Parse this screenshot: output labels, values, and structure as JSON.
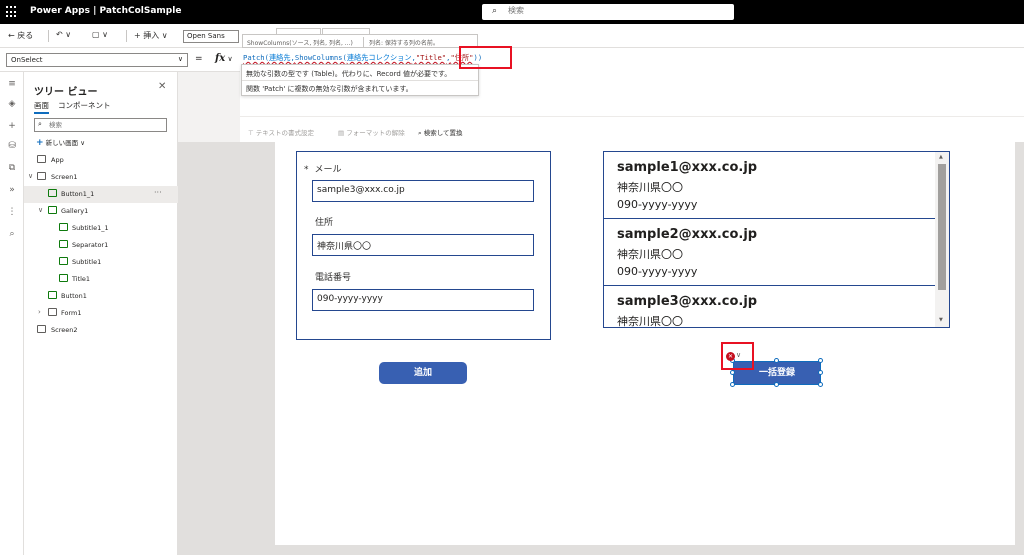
{
  "titlebar": {
    "app_title": "Power Apps | PatchColSample",
    "search_placeholder": "検索"
  },
  "commandbar": {
    "back_label": "戻る",
    "insert_label": "挿入",
    "font_value": "Open Sans"
  },
  "formulabar": {
    "property": "OnSelect",
    "equals": "=",
    "fx": "fx",
    "formula": {
      "part1": "Patch(",
      "part2": "連絡先",
      "part3": ",",
      "part4": "ShowColumns(",
      "part5": "連絡先コレクション",
      "part6": ",",
      "part7": "\"Title\"",
      "part8": ",",
      "part9": "\"住所\"",
      "part10": "))"
    },
    "tooltip_signature": "ShowColumns(ソース, 列名, 列名, ...)",
    "tooltip_param": "列名: 保持する列の名前。",
    "errors": [
      "無効な引数の型です (Table)。代わりに、Record 値が必要です。",
      "関数 'Patch' に複数の無効な引数が含まれています。"
    ],
    "text_toolbar": {
      "format_text": "テキストの書式設定",
      "remove_format": "フォーマットの解除",
      "find_replace": "検索して置換"
    }
  },
  "tree": {
    "title": "ツリー ビュー",
    "tab_screens": "画面",
    "tab_components": "コンポーネント",
    "search_placeholder": "検索",
    "new_screen": "新しい画面",
    "nodes": {
      "app": "App",
      "screen1": "Screen1",
      "button1_1": "Button1_1",
      "gallery1": "Gallery1",
      "subtitle1_1": "Subtitle1_1",
      "separator1": "Separator1",
      "subtitle1": "Subtitle1",
      "title1": "Title1",
      "button1": "Button1",
      "form1": "Form1",
      "screen2": "Screen2"
    },
    "more": "···"
  },
  "form": {
    "required_mark": "*",
    "email_label": "メール",
    "email_value": "sample3@xxx.co.jp",
    "address_label": "住所",
    "address_value": "神奈川県〇〇",
    "phone_label": "電話番号",
    "phone_value": "090-yyyy-yyyy"
  },
  "add_button": "追加",
  "bulk_button": "一括登録",
  "gallery": {
    "items": [
      {
        "title": "sample1@xxx.co.jp",
        "address": "神奈川県〇〇",
        "phone": "090-yyyy-yyyy"
      },
      {
        "title": "sample2@xxx.co.jp",
        "address": "神奈川県〇〇",
        "phone": "090-yyyy-yyyy"
      },
      {
        "title": "sample3@xxx.co.jp",
        "address": "神奈川県〇〇",
        "phone": ""
      }
    ]
  },
  "colors": {
    "accent": "#3860b2",
    "border": "#24478f",
    "error": "#e81123"
  }
}
